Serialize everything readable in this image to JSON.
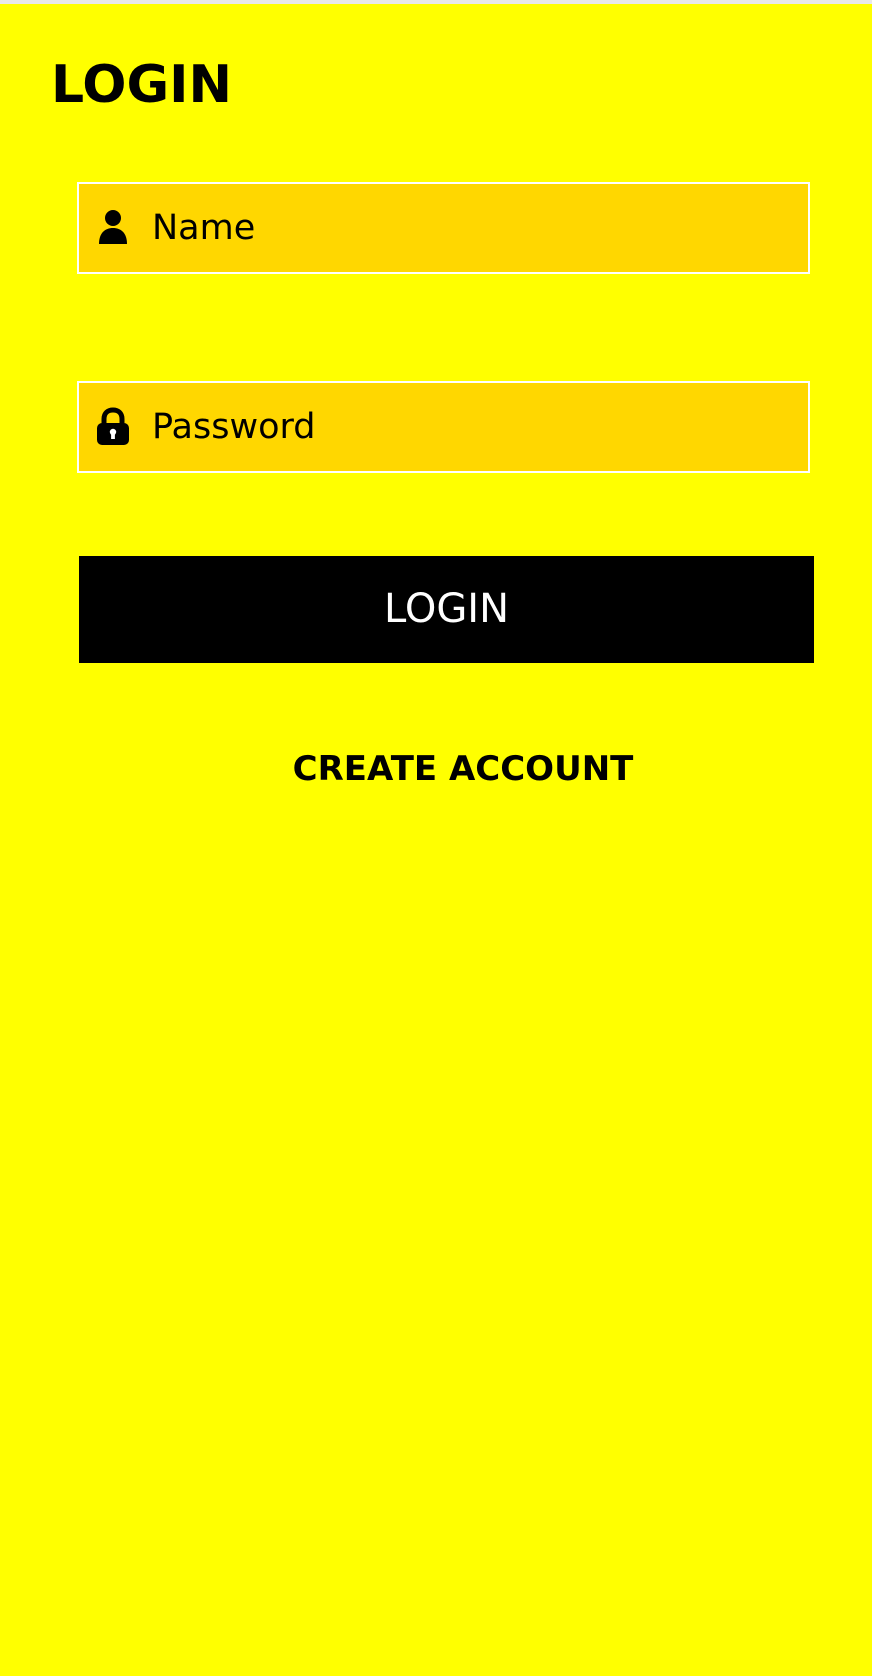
{
  "page": {
    "title": "LOGIN",
    "background_color": "#ffff00"
  },
  "form": {
    "name_field": {
      "placeholder": "Name",
      "value": "",
      "icon": "user-icon",
      "background_color": "#ffd700"
    },
    "password_field": {
      "placeholder": "Password",
      "value": "",
      "icon": "lock-icon",
      "background_color": "#ffd700"
    },
    "login_button": {
      "label": "LOGIN",
      "background_color": "#000000",
      "text_color": "#ffffff"
    },
    "create_account_link": {
      "label": "CREATE ACCOUNT"
    }
  }
}
